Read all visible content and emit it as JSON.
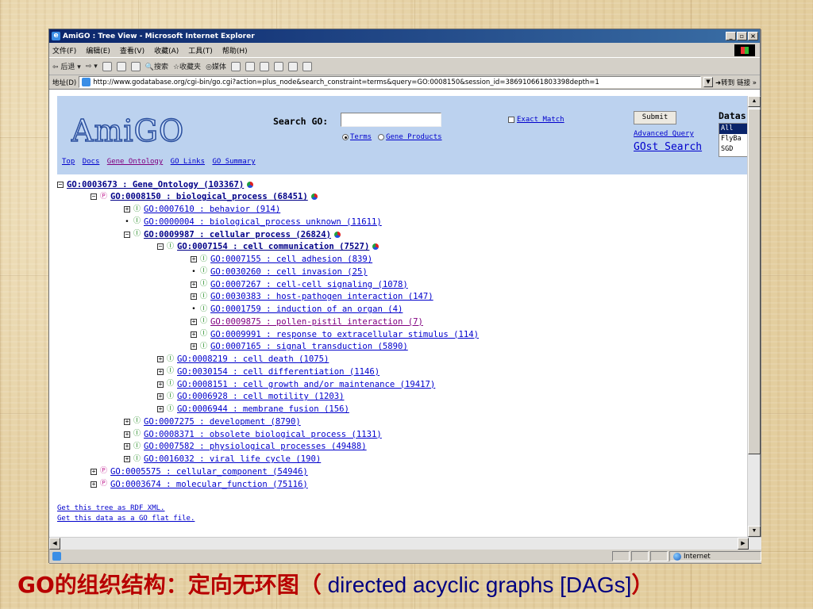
{
  "window": {
    "title": "AmiGO : Tree View - Microsoft Internet Explorer",
    "controls": [
      "_",
      "▫",
      "×"
    ]
  },
  "menubar": [
    "文件(F)",
    "编辑(E)",
    "查看(V)",
    "收藏(A)",
    "工具(T)",
    "帮助(H)"
  ],
  "toolbar": {
    "back": "后退",
    "search": "搜索",
    "favorites": "收藏夹",
    "media": "媒体"
  },
  "address": {
    "label": "地址(D)",
    "url": "http://www.godatabase.org/cgi-bin/go.cgi?action=plus_node&search_constraint=terms&query=GO:0008150&session_id=386910661803398depth=1",
    "go": "转到",
    "links": "链接 »"
  },
  "amigo": {
    "logo": "AmiGO",
    "search_label": "Search GO:",
    "search_value": "",
    "radio_terms": "Terms",
    "radio_gene": "Gene Products",
    "exact_match": "Exact Match",
    "submit": "Submit",
    "advanced_query": "Advanced Query",
    "gost_search": "GOst Search",
    "datasets_label": "Datas",
    "datasets": [
      "All",
      "FlyBa",
      "SGD"
    ],
    "nav_links": [
      "Top",
      "Docs",
      "Gene Ontology",
      "GO Links",
      "GO Summary"
    ]
  },
  "tree": [
    {
      "level": 0,
      "toggle": "minus",
      "rel": "",
      "label": "GO:0003673 : Gene_Ontology (103367)",
      "open": true,
      "ball": true
    },
    {
      "level": 1,
      "toggle": "minus",
      "rel": "part",
      "label": "GO:0008150 : biological_process (68451)",
      "open": true,
      "ball": true
    },
    {
      "level": 2,
      "toggle": "plus",
      "rel": "is",
      "label": "GO:0007610 : behavior (914)"
    },
    {
      "level": 2,
      "toggle": "dot",
      "rel": "is",
      "label": "GO:0000004 : biological_process unknown (11611)"
    },
    {
      "level": 2,
      "toggle": "minus",
      "rel": "is",
      "label": "GO:0009987 : cellular process (26824)",
      "open": true,
      "ball": true
    },
    {
      "level": 3,
      "toggle": "minus",
      "rel": "is",
      "label": "GO:0007154 : cell communication (7527)",
      "open": true,
      "ball": true
    },
    {
      "level": 4,
      "toggle": "plus",
      "rel": "is",
      "label": "GO:0007155 : cell adhesion (839)"
    },
    {
      "level": 4,
      "toggle": "dot",
      "rel": "is",
      "label": "GO:0030260 : cell invasion (25)"
    },
    {
      "level": 4,
      "toggle": "plus",
      "rel": "is",
      "label": "GO:0007267 : cell-cell signaling (1078)"
    },
    {
      "level": 4,
      "toggle": "plus",
      "rel": "is",
      "label": "GO:0030383 : host-pathogen interaction (147)"
    },
    {
      "level": 4,
      "toggle": "dot",
      "rel": "is",
      "label": "GO:0001759 : induction of an organ (4)"
    },
    {
      "level": 4,
      "toggle": "plus",
      "rel": "is",
      "label": "GO:0009875 : pollen-pistil interaction (7)",
      "visited": true
    },
    {
      "level": 4,
      "toggle": "plus",
      "rel": "is",
      "label": "GO:0009991 : response to extracellular stimulus (114)"
    },
    {
      "level": 4,
      "toggle": "plus",
      "rel": "is",
      "label": "GO:0007165 : signal transduction (5890)"
    },
    {
      "level": 3,
      "toggle": "plus",
      "rel": "is",
      "label": "GO:0008219 : cell death (1075)"
    },
    {
      "level": 3,
      "toggle": "plus",
      "rel": "is",
      "label": "GO:0030154 : cell differentiation (1146)"
    },
    {
      "level": 3,
      "toggle": "plus",
      "rel": "is",
      "label": "GO:0008151 : cell growth and/or maintenance (19417)"
    },
    {
      "level": 3,
      "toggle": "plus",
      "rel": "is",
      "label": "GO:0006928 : cell motility (1203)"
    },
    {
      "level": 3,
      "toggle": "plus",
      "rel": "is",
      "label": "GO:0006944 : membrane fusion (156)"
    },
    {
      "level": 2,
      "toggle": "plus",
      "rel": "is",
      "label": "GO:0007275 : development (8790)"
    },
    {
      "level": 2,
      "toggle": "plus",
      "rel": "is",
      "label": "GO:0008371 : obsolete biological process (1131)"
    },
    {
      "level": 2,
      "toggle": "plus",
      "rel": "is",
      "label": "GO:0007582 : physiological processes (49488)"
    },
    {
      "level": 2,
      "toggle": "plus",
      "rel": "is",
      "label": "GO:0016032 : viral life cycle (190)"
    },
    {
      "level": 1,
      "toggle": "plus",
      "rel": "part",
      "label": "GO:0005575 : cellular_component (54946)"
    },
    {
      "level": 1,
      "toggle": "plus",
      "rel": "part",
      "label": "GO:0003674 : molecular_function (75116)"
    }
  ],
  "bottom_links": [
    "Get this tree as RDF XML.",
    "Get this data as a GO flat file."
  ],
  "status": {
    "zone": "Internet"
  },
  "caption": {
    "cn_prefix": "GO的组织结构：定向无环图（",
    "en": " directed acyclic graphs [DAGs]",
    "cn_suffix": "）"
  }
}
